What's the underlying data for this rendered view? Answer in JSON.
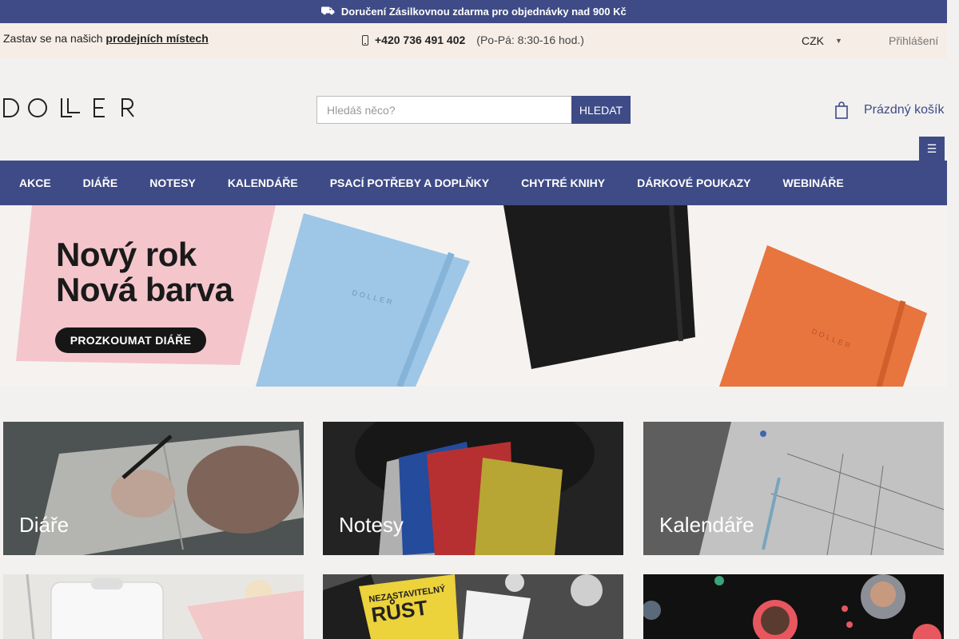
{
  "topbar": {
    "message": "Doručení Zásilkovnou zdarma pro objednávky nad 900 Kč",
    "icon": "truck-icon"
  },
  "infobar": {
    "visit_prefix": "Zastav se na našich",
    "visit_link": "prodejních místech",
    "phone_icon": "phone-icon",
    "phone": "+420 736 491 402",
    "hours": "(Po-Pá: 8:30-16 hod.)",
    "currency": "CZK",
    "login": "Přihlášení"
  },
  "header": {
    "logo_text": "DOLLER",
    "search_placeholder": "Hledáš něco?",
    "search_button": "HLEDAT",
    "cart_label": "Prázdný košík"
  },
  "nav": {
    "items": [
      "AKCE",
      "DIÁŘE",
      "NOTESY",
      "KALENDÁŘE",
      "PSACÍ POTŘEBY A DOPLŇKY",
      "CHYTRÉ KNIHY",
      "DÁRKOVÉ POUKAZY",
      "WEBINÁŘE"
    ]
  },
  "hero": {
    "title_line1": "Nový rok",
    "title_line2": "Nová barva",
    "cta": "PROZKOUMAT DIÁŘE",
    "product_brand": "DOLLER"
  },
  "categories": [
    {
      "label": "Diáře"
    },
    {
      "label": "Notesy"
    },
    {
      "label": "Kalendáře"
    }
  ],
  "bottom_tiles": {
    "book_title_line1": "NEZASTAVITELNÝ",
    "book_title_line2": "RŮST"
  },
  "colors": {
    "brand": "#3e4b86",
    "infobar_bg": "#f5ede6",
    "page_bg": "#f2f1f0"
  }
}
